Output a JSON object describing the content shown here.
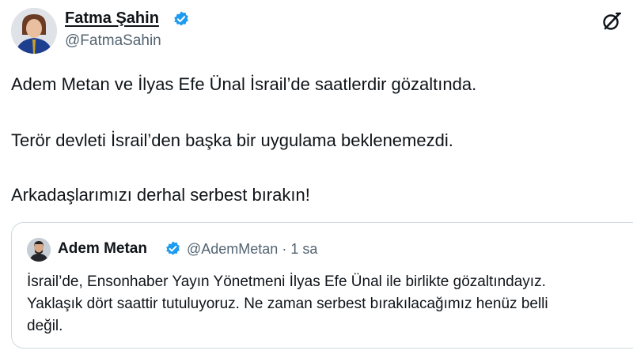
{
  "author": {
    "name": "Fatma Şahin",
    "handle": "@FatmaSahin"
  },
  "tweet": {
    "lines": [
      "Adem Metan ve İlyas Efe Ünal İsrail’de saatlerdir gözaltında.",
      "Terör devleti İsrail’den başka bir uygulama beklenemezdi.",
      "Arkadaşlarımızı derhal serbest bırakın!"
    ]
  },
  "quoted": {
    "name": "Adem Metan",
    "meta": "@AdemMetan · 1 sa",
    "lines": [
      "İsrail’de, Ensonhaber Yayın Yönetmeni İlyas Efe Ünal ile birlikte gözaltındayız.",
      "Yaklaşık dört saattir tutuluyoruz. Ne zaman serbest bırakılacağımız henüz belli",
      "değil."
    ]
  },
  "icons": {
    "verified": "verified-badge-icon",
    "grok": "grok-icon"
  },
  "colors": {
    "text": "#0f1419",
    "secondary": "#536471",
    "verified": "#1d9bf0",
    "border": "#cfd9de"
  }
}
